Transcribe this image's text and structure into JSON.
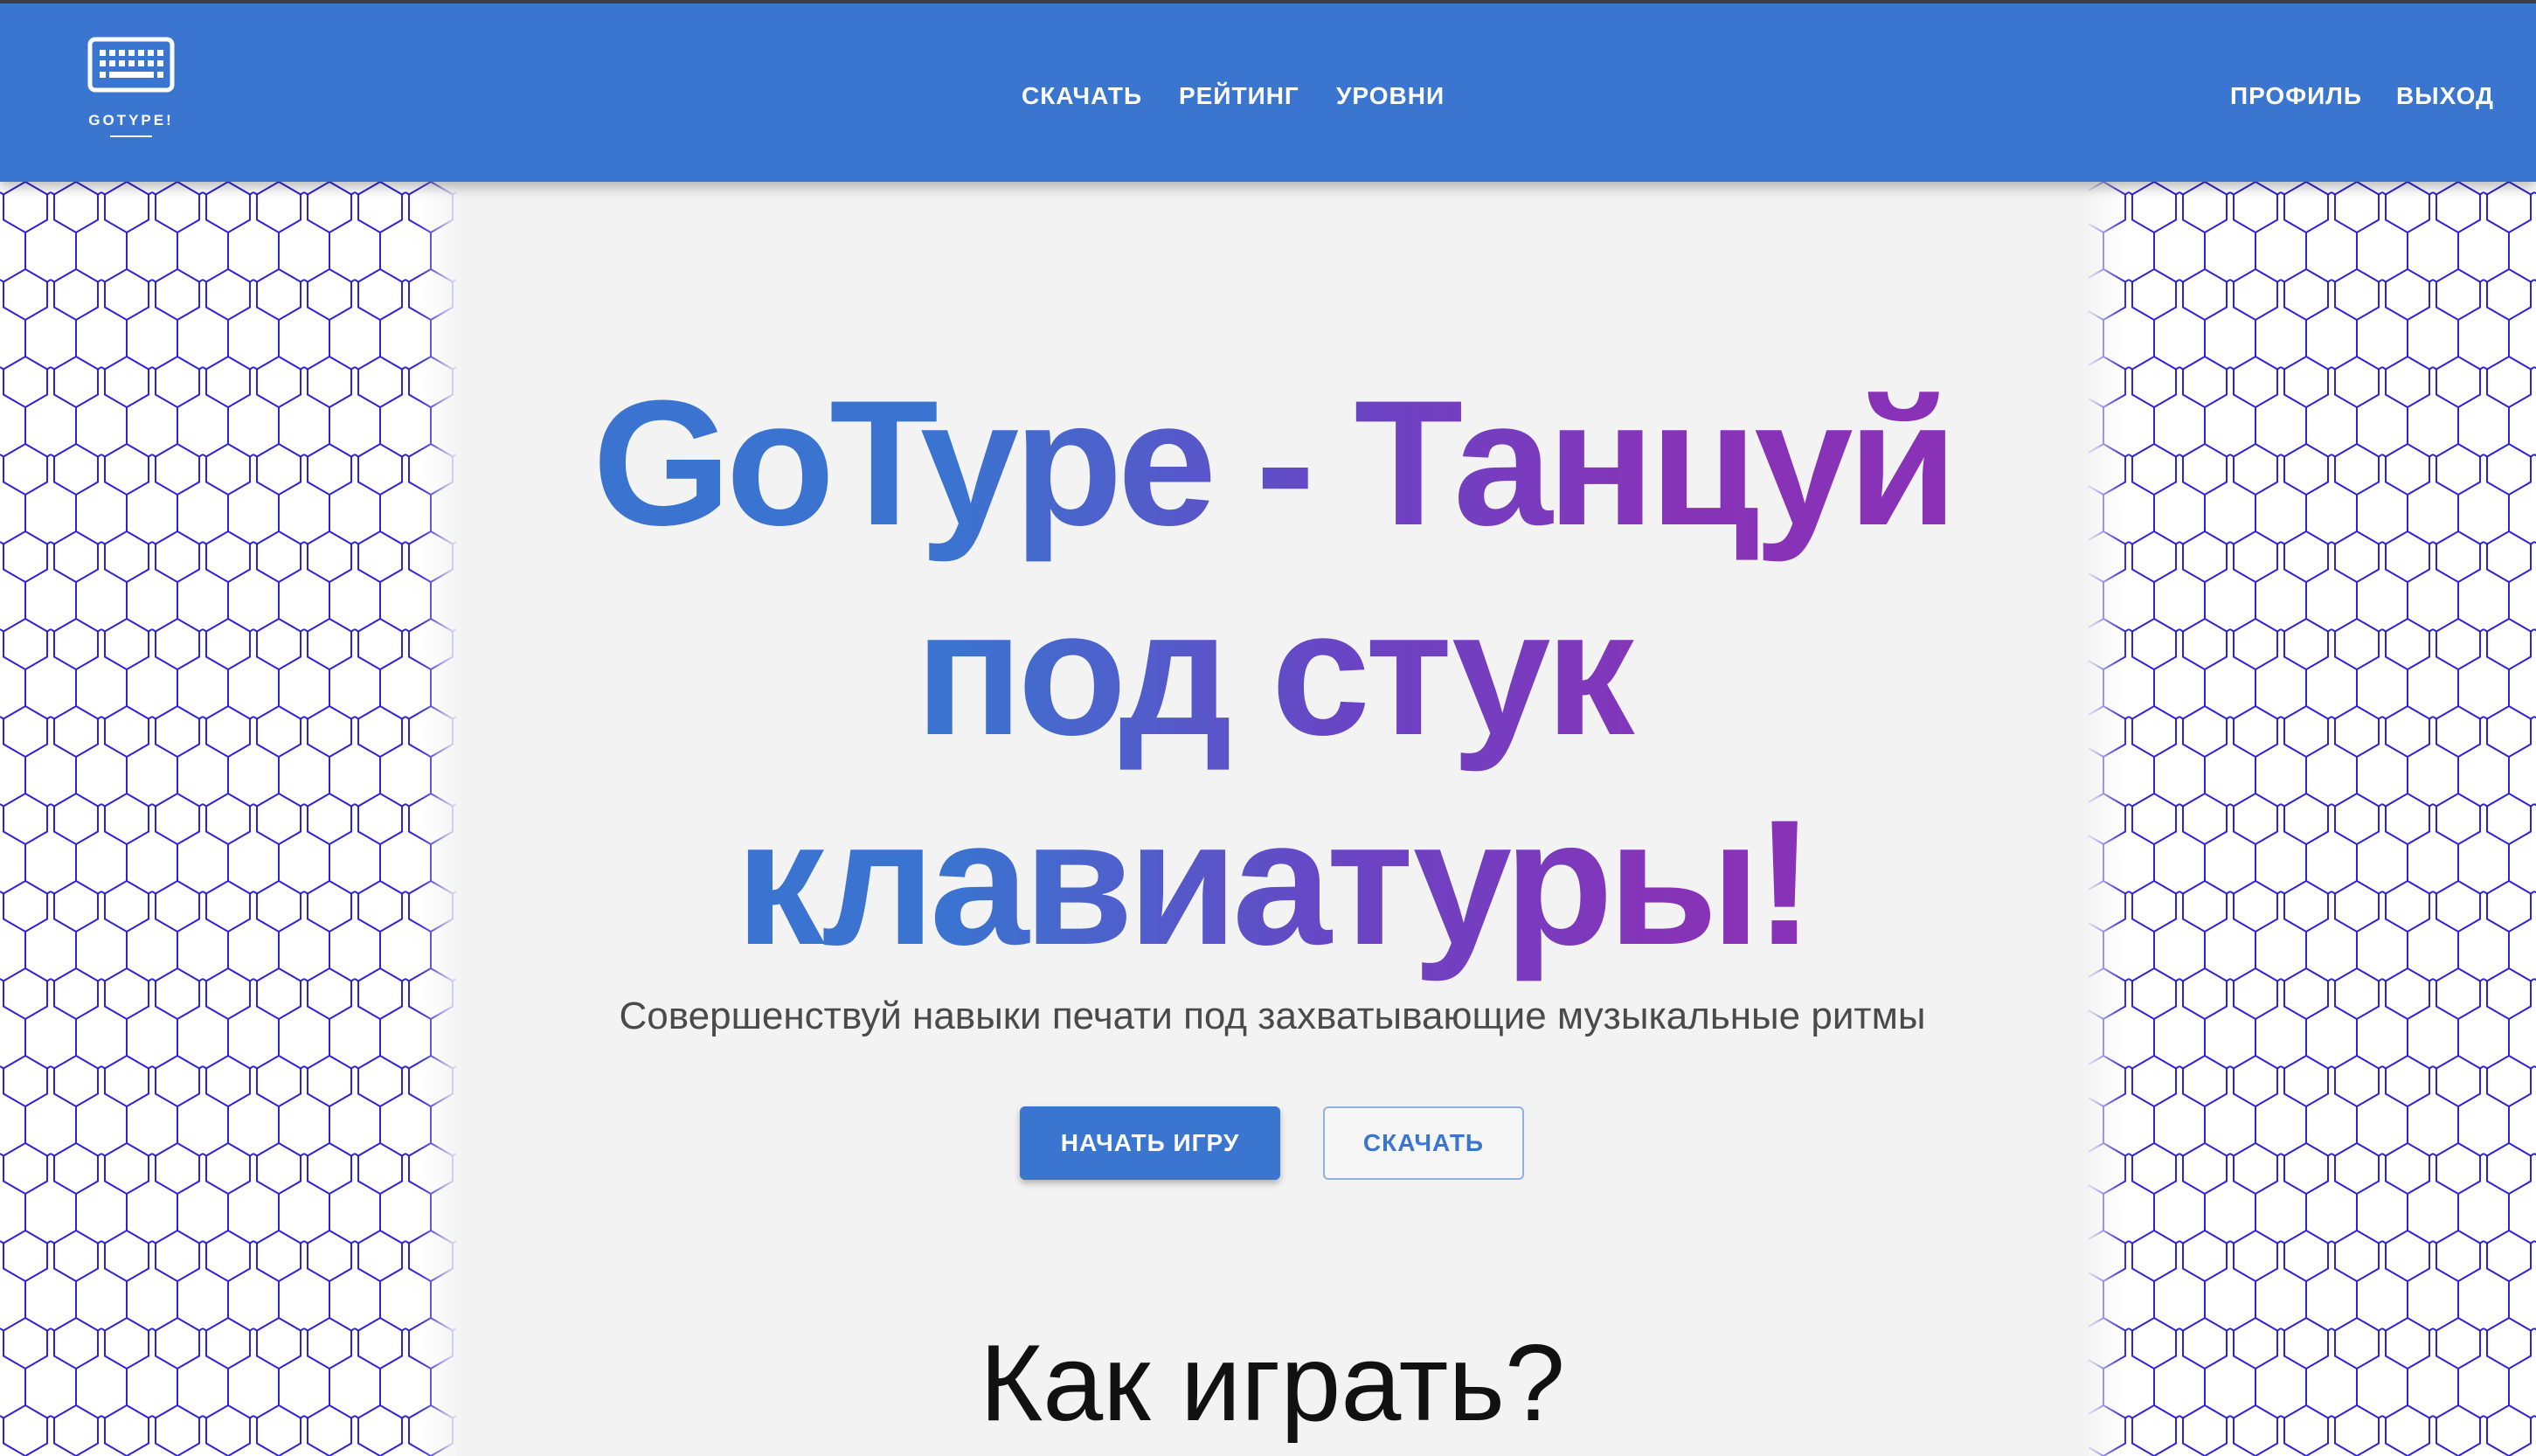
{
  "app": {
    "brand_name": "GOTYPE!"
  },
  "nav": {
    "center_links": [
      {
        "label": "СКАЧАТЬ"
      },
      {
        "label": "РЕЙТИНГ"
      },
      {
        "label": "УРОВНИ"
      }
    ],
    "right_links": [
      {
        "label": "ПРОФИЛЬ"
      },
      {
        "label": "ВЫХОД"
      }
    ]
  },
  "hero": {
    "title_line1_part1": "GoType - ",
    "title_line1_part2": "Танцуй",
    "title_line2": "под стук",
    "title_line3": "клавиатуры!",
    "subtitle": "Совершенствуй навыки печати под захватывающие музыкальные ритмы",
    "primary_button": "НАЧАТЬ ИГРУ",
    "secondary_button": "СКАЧАТЬ"
  },
  "section": {
    "how_to_play_title": "Как играть?"
  },
  "icons": {
    "logo": "keyboard-icon"
  },
  "colors": {
    "brand": "#3a75cf",
    "accent_purple": "#8a31b6",
    "panel": "#f3f3f3",
    "hex_pattern": "#2e22d6"
  }
}
